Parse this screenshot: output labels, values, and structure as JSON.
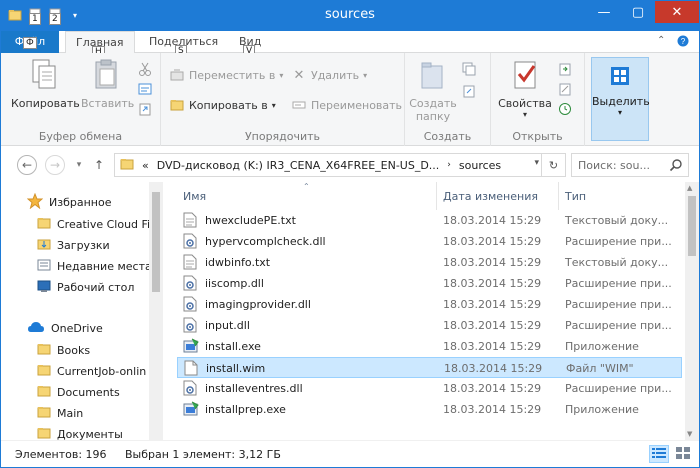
{
  "window": {
    "title": "sources"
  },
  "qat": {
    "keytip_1": "1",
    "keytip_2": "2"
  },
  "tabs": {
    "file": "Файл",
    "file_keytip": "Ф",
    "home": "Главная",
    "home_keytip": "H",
    "share": "Поделиться",
    "share_keytip": "S",
    "view": "Вид",
    "view_keytip": "V"
  },
  "ribbon": {
    "clipboard": {
      "label": "Буфер обмена",
      "copy": "Копировать",
      "paste": "Вставить"
    },
    "organize": {
      "label": "Упорядочить",
      "move_to": "Переместить в",
      "copy_to": "Копировать в",
      "delete": "Удалить",
      "rename": "Переименовать"
    },
    "new": {
      "label": "Создать",
      "new_folder_line1": "Создать",
      "new_folder_line2": "папку"
    },
    "open": {
      "label": "Открыть",
      "properties": "Свойства"
    },
    "select": {
      "label": "Выделить"
    }
  },
  "address": {
    "overflow": "«",
    "segment_1": "DVD-дисковод (K:) IR3_CENA_X64FREE_EN-US_D...",
    "segment_2": "sources",
    "search_placeholder": "Поиск: sou..."
  },
  "navpane": {
    "favorites": "Избранное",
    "items": [
      {
        "label": "Creative Cloud Fi"
      },
      {
        "label": "Загрузки"
      },
      {
        "label": "Недавние места"
      },
      {
        "label": "Рабочий стол"
      }
    ],
    "onedrive": "OneDrive",
    "onedrive_items": [
      {
        "label": "Books"
      },
      {
        "label": "CurrentJob-onlin"
      },
      {
        "label": "Documents"
      },
      {
        "label": "Main"
      },
      {
        "label": "Документы"
      }
    ]
  },
  "columns": {
    "name": "Имя",
    "date": "Дата изменения",
    "type": "Тип"
  },
  "files": [
    {
      "name": "hwexcludePE.txt",
      "date": "18.03.2014 15:29",
      "type": "Текстовый доку...",
      "icon": "text-file-icon"
    },
    {
      "name": "hypervcomplcheck.dll",
      "date": "18.03.2014 15:29",
      "type": "Расширение при...",
      "icon": "dll-file-icon"
    },
    {
      "name": "idwbinfo.txt",
      "date": "18.03.2014 15:29",
      "type": "Текстовый доку...",
      "icon": "text-file-icon"
    },
    {
      "name": "iiscomp.dll",
      "date": "18.03.2014 15:29",
      "type": "Расширение при...",
      "icon": "dll-file-icon"
    },
    {
      "name": "imagingprovider.dll",
      "date": "18.03.2014 15:29",
      "type": "Расширение при...",
      "icon": "dll-file-icon"
    },
    {
      "name": "input.dll",
      "date": "18.03.2014 15:29",
      "type": "Расширение при...",
      "icon": "dll-file-icon"
    },
    {
      "name": "install.exe",
      "date": "18.03.2014 15:29",
      "type": "Приложение",
      "icon": "exe-file-icon"
    },
    {
      "name": "install.wim",
      "date": "18.03.2014 15:29",
      "type": "Файл \"WIM\"",
      "icon": "generic-file-icon"
    },
    {
      "name": "installeventres.dll",
      "date": "18.03.2014 15:29",
      "type": "Расширение при...",
      "icon": "dll-file-icon"
    },
    {
      "name": "installprep.exe",
      "date": "18.03.2014 15:29",
      "type": "Приложение",
      "icon": "exe-file-icon"
    }
  ],
  "status": {
    "count": "Элементов: 196",
    "selection": "Выбран 1 элемент: 3,12 ГБ"
  },
  "colors": {
    "accent": "#1e7bd6",
    "selection": "#cce8ff",
    "close": "#c7392b"
  }
}
